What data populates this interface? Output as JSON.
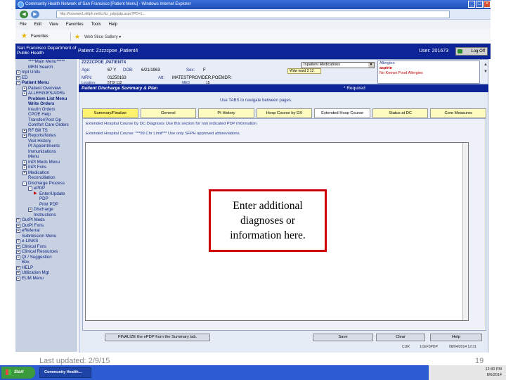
{
  "window": {
    "title": "Community Health Network of San Francisco [Patient Menu] - Windows Internet Explorer",
    "url": "http://lcrswww1.sfdph.net/lcr/lcr_pdp/pdp.aspx?PD=1..."
  },
  "menubar": [
    "File",
    "Edit",
    "View",
    "Favorites",
    "Tools",
    "Help"
  ],
  "favbar": {
    "favorites": "Favorites",
    "web_slice": "Web Slice Gallery ▾"
  },
  "header": {
    "org": "San Francisco Department of Public Health",
    "patient": "Patient: Zzzzcpoe ,Patient4",
    "user": "User: 201673",
    "logoff": "Log Off"
  },
  "leftnav": [
    {
      "label": "****Main Menu*****",
      "indent": 1,
      "bold": false
    },
    {
      "label": "MRN Search",
      "indent": 1,
      "bold": false
    },
    {
      "label": "Inpt Units",
      "indent": 0,
      "bold": false,
      "expander": "+"
    },
    {
      "label": "ED",
      "indent": 0,
      "bold": false,
      "expander": "+"
    },
    {
      "label": "Patient Menu",
      "indent": 0,
      "bold": true,
      "expander": "-"
    },
    {
      "label": "Patient Overview",
      "indent": 1,
      "bold": false,
      "expander": "+"
    },
    {
      "label": "ALLERGIES/ADRs",
      "indent": 1,
      "bold": false,
      "expander": "+"
    },
    {
      "label": "Problem List Menu",
      "indent": 1,
      "bold": true
    },
    {
      "label": "Write Orders",
      "indent": 1,
      "bold": true
    },
    {
      "label": "Insulin Orders",
      "indent": 1,
      "bold": false
    },
    {
      "label": "CPOE Help",
      "indent": 1,
      "bold": false
    },
    {
      "label": "Transfer/Post Op",
      "indent": 1,
      "bold": false
    },
    {
      "label": "Comfort Care Orders",
      "indent": 1,
      "bold": false
    },
    {
      "label": "RF Bill TS",
      "indent": 1,
      "bold": false,
      "expander": "+"
    },
    {
      "label": "Reports/Notes",
      "indent": 1,
      "bold": false,
      "expander": "+"
    },
    {
      "label": "Visit History",
      "indent": 1,
      "bold": false
    },
    {
      "label": "Pt Appointments",
      "indent": 1,
      "bold": false
    },
    {
      "label": "Immunizations",
      "indent": 1,
      "bold": false
    },
    {
      "label": "Menu",
      "indent": 1,
      "bold": false
    },
    {
      "label": "InPt Meds Menu",
      "indent": 1,
      "bold": false,
      "expander": "+"
    },
    {
      "label": "InPt Fxns",
      "indent": 1,
      "bold": false,
      "expander": "+"
    },
    {
      "label": "Medication",
      "indent": 1,
      "bold": false,
      "expander": "+"
    },
    {
      "label": "Reconciliation",
      "indent": 1,
      "bold": false
    },
    {
      "label": "Discharge Process",
      "indent": 1,
      "bold": false,
      "expander": "-"
    },
    {
      "label": "ePDP",
      "indent": 2,
      "bold": false,
      "expander": "-"
    },
    {
      "label": "Enter/Update",
      "indent": 3,
      "bold": false,
      "arrow": true
    },
    {
      "label": "PDP",
      "indent": 3,
      "bold": false
    },
    {
      "label": "Print PDP",
      "indent": 3,
      "bold": false
    },
    {
      "label": "Discharge",
      "indent": 2,
      "bold": false,
      "expander": "+"
    },
    {
      "label": "Instructions",
      "indent": 2,
      "bold": false
    },
    {
      "label": "OutPt Meds",
      "indent": 0,
      "bold": false,
      "expander": "+"
    },
    {
      "label": "OutPt Fxns",
      "indent": 0,
      "bold": false,
      "expander": "+"
    },
    {
      "label": "eReferral",
      "indent": 0,
      "bold": false,
      "expander": "+"
    },
    {
      "label": "Submission Menu",
      "indent": 0,
      "bold": false
    },
    {
      "label": "e-LINKS",
      "indent": 0,
      "bold": false,
      "expander": "+"
    },
    {
      "label": "Clinical Fxns",
      "indent": 0,
      "bold": false,
      "expander": "+"
    },
    {
      "label": "Clinical Resources",
      "indent": 0,
      "bold": false,
      "expander": "+"
    },
    {
      "label": "QI / Suggestion",
      "indent": 0,
      "bold": false,
      "expander": "+"
    },
    {
      "label": "Box",
      "indent": 0,
      "bold": false
    },
    {
      "label": "HELP",
      "indent": 0,
      "bold": false,
      "expander": "+"
    },
    {
      "label": "Utilization Mgt",
      "indent": 0,
      "bold": false,
      "expander": "+"
    },
    {
      "label": "EUM Menu",
      "indent": 0,
      "bold": false,
      "expander": "+"
    }
  ],
  "patient_strip": {
    "name": "ZZZZCPOE ,PATIENT4",
    "age_label": "Age:",
    "age": "67 Y",
    "dob_label": "DOB:",
    "dob": "6/21/1963",
    "sex_label": "Sex:",
    "sex": "F",
    "mrn_label": "MRN:",
    "mrn": "01250163",
    "att_label": "Att:",
    "att": "MATESTPROVIDER,POEMDR:",
    "encounter": "Wdw ward 2 12",
    "med_select": "Inpatient Medications",
    "allergies_label": "Allergies:",
    "allergy1": "aspirin",
    "allergy2": "No Known Food Allergies",
    "loc_label": "Location:",
    "loc": "5TO/ 112",
    "med_label": "MED",
    "med_val": "15"
  },
  "discharge": {
    "title": "Patient Discharge Summary & Plan",
    "required": "* Required"
  },
  "tabs": {
    "hint": "Use TABS to navigate between pages.",
    "items": [
      "Summary/Finalize",
      "General",
      "Pt History",
      "Hosp Course by DX",
      "Extended Hosp Course",
      "Status at DC",
      "Core Measures"
    ],
    "active_index": 4
  },
  "panel": {
    "row1": "Extended Hospital Course by DC Diagnosis     Use this section for non indicated PDP information",
    "row2": "Extended Hospital Course:              ***99 Chr Limit***        Use only SFPH approved abbreviations."
  },
  "callout": "Enter additional diagnoses or information here.",
  "buttons": {
    "finalize": "FINALIZE the ePDP from the Summary tab.",
    "save": "Save",
    "clear": "Clear",
    "help": "Help"
  },
  "status": {
    "cur": "CUR",
    "form": "1CEF0PDP",
    "timestamp": "08/04/2014 12:31"
  },
  "slide": {
    "updated": "Last updated: 2/9/15",
    "page": "19"
  },
  "taskbar": {
    "start": "Start",
    "app": "Community Health...",
    "time": "12:30 PM",
    "date": "8/6/2014"
  }
}
